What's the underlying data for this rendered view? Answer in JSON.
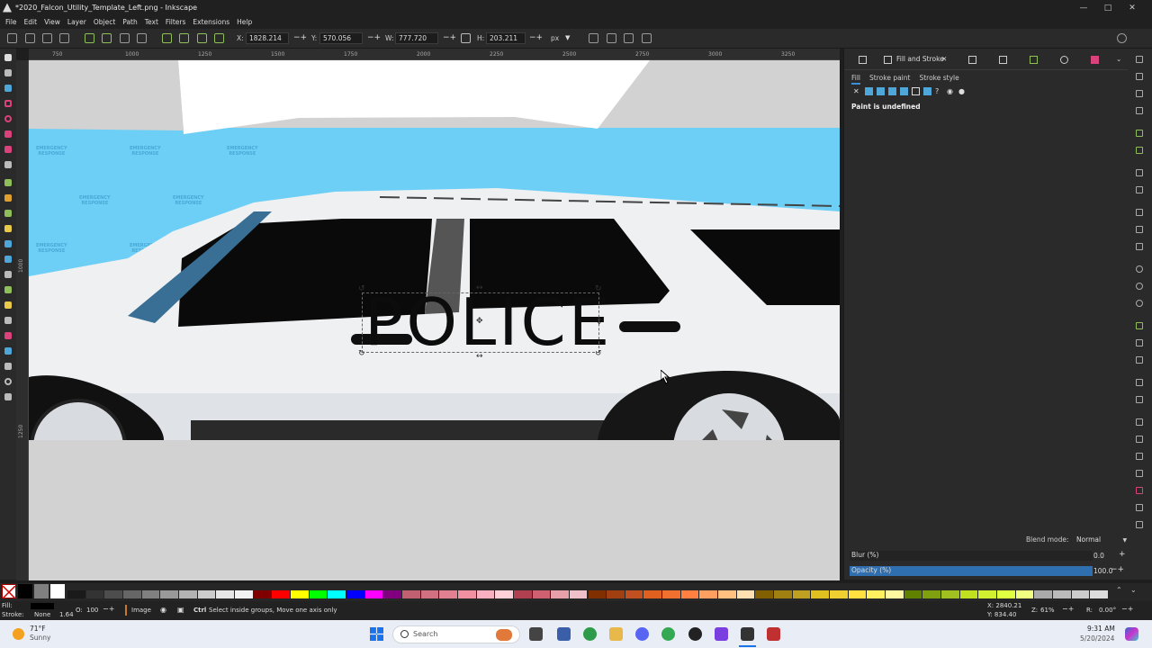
{
  "window": {
    "title": "*2020_Falcon_Utility_Template_Left.png - Inkscape"
  },
  "menu": [
    "File",
    "Edit",
    "View",
    "Layer",
    "Object",
    "Path",
    "Text",
    "Filters",
    "Extensions",
    "Help"
  ],
  "toolbar": {
    "x_label": "X:",
    "x_value": "1828.214",
    "y_label": "Y:",
    "y_value": "570.056",
    "w_label": "W:",
    "w_value": "777.720",
    "h_label": "H:",
    "h_value": "203.211",
    "unit": "px"
  },
  "ruler_top": [
    "750",
    "1000",
    "1250",
    "1500",
    "1750",
    "2000",
    "2250",
    "2500",
    "2750",
    "3000",
    "3250"
  ],
  "ruler_left": [
    "1000",
    "1250"
  ],
  "canvas": {
    "police_text": "POLICE",
    "watermark": "EMERGENCY\nRESPONSE"
  },
  "panel": {
    "tab_title": "Fill and Stroke",
    "subtabs": [
      "Fill",
      "Stroke paint",
      "Stroke style"
    ],
    "undefined_msg": "Paint is undefined",
    "blend_label": "Blend mode:",
    "blend_value": "Normal",
    "blur_label": "Blur (%)",
    "blur_value": "0.0",
    "opacity_label": "Opacity (%)",
    "opacity_value": "100.0"
  },
  "status": {
    "fill_label": "Fill:",
    "stroke_label": "Stroke:",
    "stroke_value": "None",
    "stroke_width": "1.64",
    "opacity_label": "O:",
    "opacity_value": "100",
    "layer": "Image",
    "hint_key": "Ctrl",
    "hint_text": "Select inside groups, Move one axis only",
    "x_coord": "X: 2840.21",
    "y_coord": "Y: 834.40",
    "zoom_label": "Z:",
    "zoom_value": "61%",
    "rot_label": "R:",
    "rot_value": "0.00°"
  },
  "taskbar": {
    "temp": "71°F",
    "weather": "Sunny",
    "search": "Search",
    "time": "9:31 AM",
    "date": "5/20/2024"
  },
  "colors": {
    "accent": "#3b8fd9",
    "sky": "#6ecff6"
  }
}
